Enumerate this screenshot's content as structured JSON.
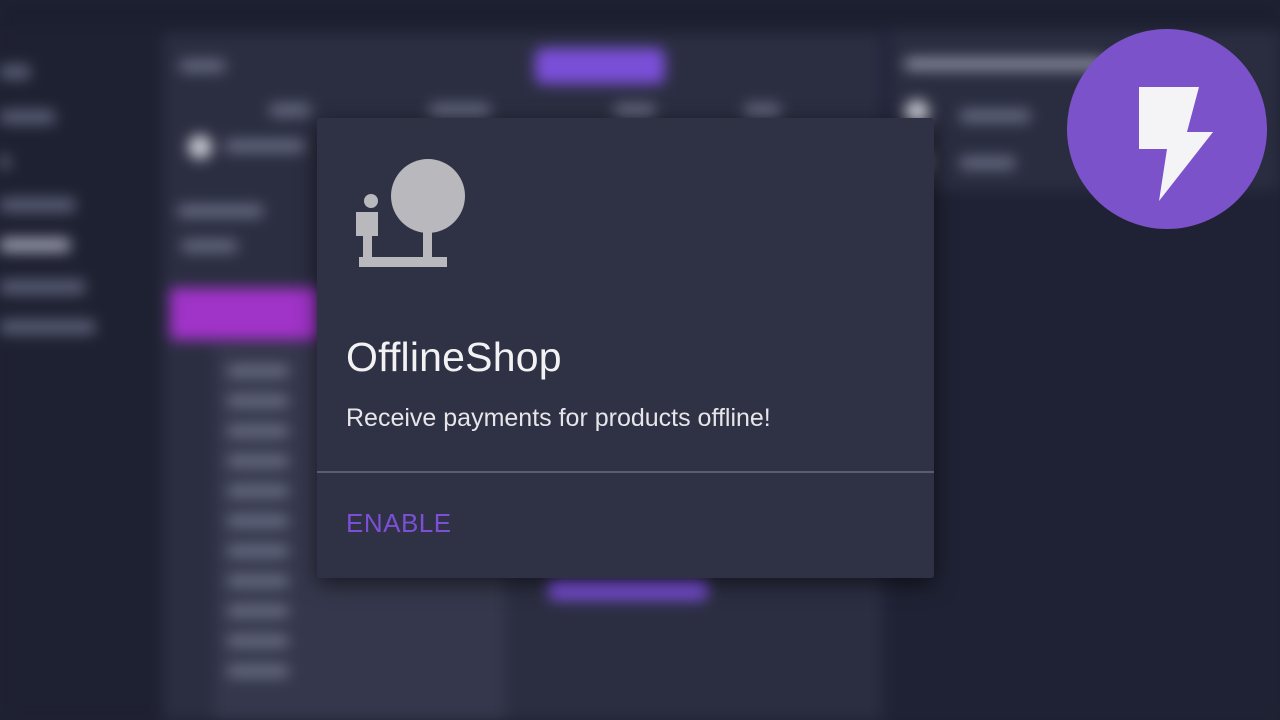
{
  "extension_card": {
    "icon": "offline-shop-icon",
    "title": "OfflineShop",
    "description": "Receive payments for products offline!",
    "action_label": "ENABLE"
  },
  "logo": {
    "icon": "lightning-bolt-icon"
  },
  "colors": {
    "accent": "#7b4fd6",
    "card_background": "#2f3244",
    "page_background": "#1f2233",
    "logo_background": "#7b52c9",
    "icon_gray": "#b9b9bd"
  }
}
